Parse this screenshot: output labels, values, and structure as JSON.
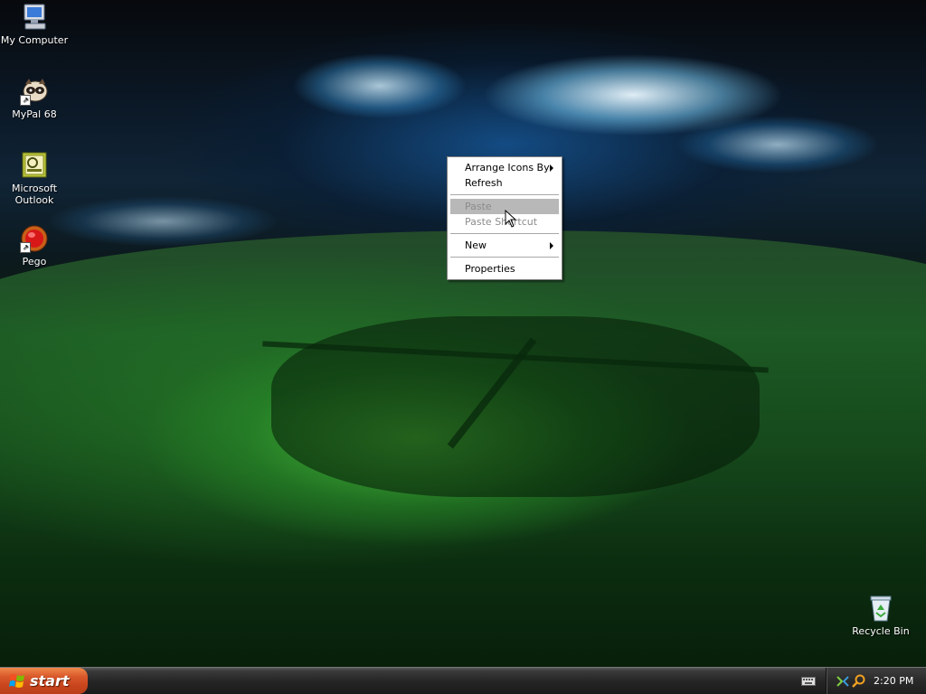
{
  "desktop": {
    "icons": [
      {
        "label": "My Computer",
        "icon": "my-computer-icon"
      },
      {
        "label": "MyPal 68",
        "icon": "mypal-browser-icon",
        "shortcut": true
      },
      {
        "label": "Microsoft Outlook",
        "icon": "outlook-icon"
      },
      {
        "label": "Pego",
        "icon": "pego-icon",
        "shortcut": true
      },
      {
        "label": "Recycle Bin",
        "icon": "recycle-bin-icon"
      }
    ]
  },
  "context_menu": {
    "items": [
      {
        "label": "Arrange Icons By",
        "submenu": true,
        "enabled": true
      },
      {
        "label": "Refresh",
        "enabled": true
      },
      {
        "label": "Paste",
        "enabled": false,
        "highlighted": true
      },
      {
        "label": "Paste Shortcut",
        "enabled": false
      },
      {
        "label": "New",
        "submenu": true,
        "enabled": true
      },
      {
        "label": "Properties",
        "enabled": true
      }
    ]
  },
  "taskbar": {
    "start_label": "start",
    "clock": "2:20 PM",
    "tray_icons": [
      "network-icon",
      "search-icon"
    ],
    "quick_icons": [
      "keyboard-icon"
    ]
  },
  "colors": {
    "start_button": "#d8572a",
    "taskbar": "#262626",
    "menu_highlight": "#b8b8b8"
  }
}
